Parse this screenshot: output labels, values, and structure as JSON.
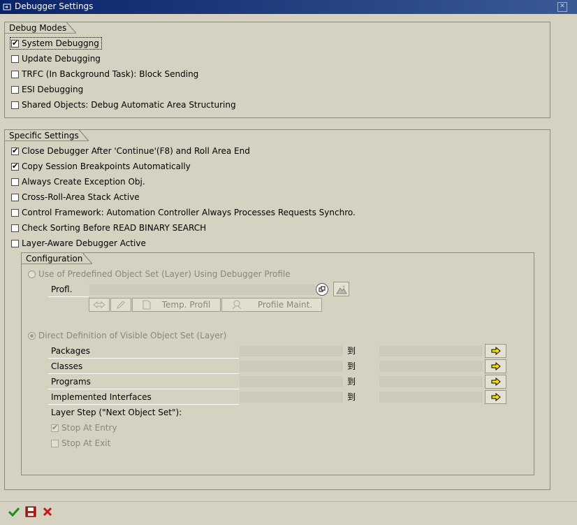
{
  "window": {
    "title": "Debugger Settings"
  },
  "debug_modes": {
    "title": "Debug Modes",
    "items": [
      {
        "label": "System Debuggng",
        "checked": true
      },
      {
        "label": "Update Debugging",
        "checked": false
      },
      {
        "label": "TRFC (In Background Task): Block Sending",
        "checked": false
      },
      {
        "label": "ESI Debugging",
        "checked": false
      },
      {
        "label": "Shared Objects: Debug Automatic Area Structuring",
        "checked": false
      }
    ]
  },
  "specific_settings": {
    "title": "Specific Settings",
    "items": [
      {
        "label": "Close Debugger After 'Continue'(F8) and Roll Area End",
        "checked": true
      },
      {
        "label": "Copy Session Breakpoints Automatically",
        "checked": true
      },
      {
        "label": "Always Create Exception Obj.",
        "checked": false
      },
      {
        "label": "Cross-Roll-Area Stack Active",
        "checked": false
      },
      {
        "label": "Control Framework: Automation Controller Always Processes Requests Synchro.",
        "checked": false
      },
      {
        "label": "Check Sorting Before READ BINARY SEARCH",
        "checked": false
      },
      {
        "label": "Layer-Aware Debugger Active",
        "checked": false
      }
    ]
  },
  "configuration": {
    "title": "Configuration",
    "predefined_radio": "Use of Predefined Object Set (Layer) Using Debugger Profile",
    "profile_label": "Profl.",
    "profile_value": "",
    "temp_profile_button": "Temp. Profil",
    "profile_maint_button": "Profile Maint.",
    "direct_radio": "Direct Definition of Visible Object Set (Layer)",
    "to_label": "到",
    "ranges": [
      {
        "label": "Packages",
        "from": "",
        "to": ""
      },
      {
        "label": "Classes",
        "from": "",
        "to": ""
      },
      {
        "label": "Programs",
        "from": "",
        "to": ""
      },
      {
        "label": "Implemented Interfaces",
        "from": "",
        "to": ""
      }
    ],
    "layer_step_label": "Layer Step (\"Next Object Set\"):",
    "stop_at_entry": {
      "label": "Stop At Entry",
      "checked": true
    },
    "stop_at_exit": {
      "label": "Stop At Exit",
      "checked": false
    }
  },
  "footer": {
    "icons": [
      "checkmark-icon",
      "save-icon",
      "cancel-icon"
    ]
  },
  "colors": {
    "title_bar": "#0a246a",
    "dialog_bg": "#d5d2c2",
    "ok_green": "#1c8a1c",
    "cancel_red": "#c01818"
  }
}
